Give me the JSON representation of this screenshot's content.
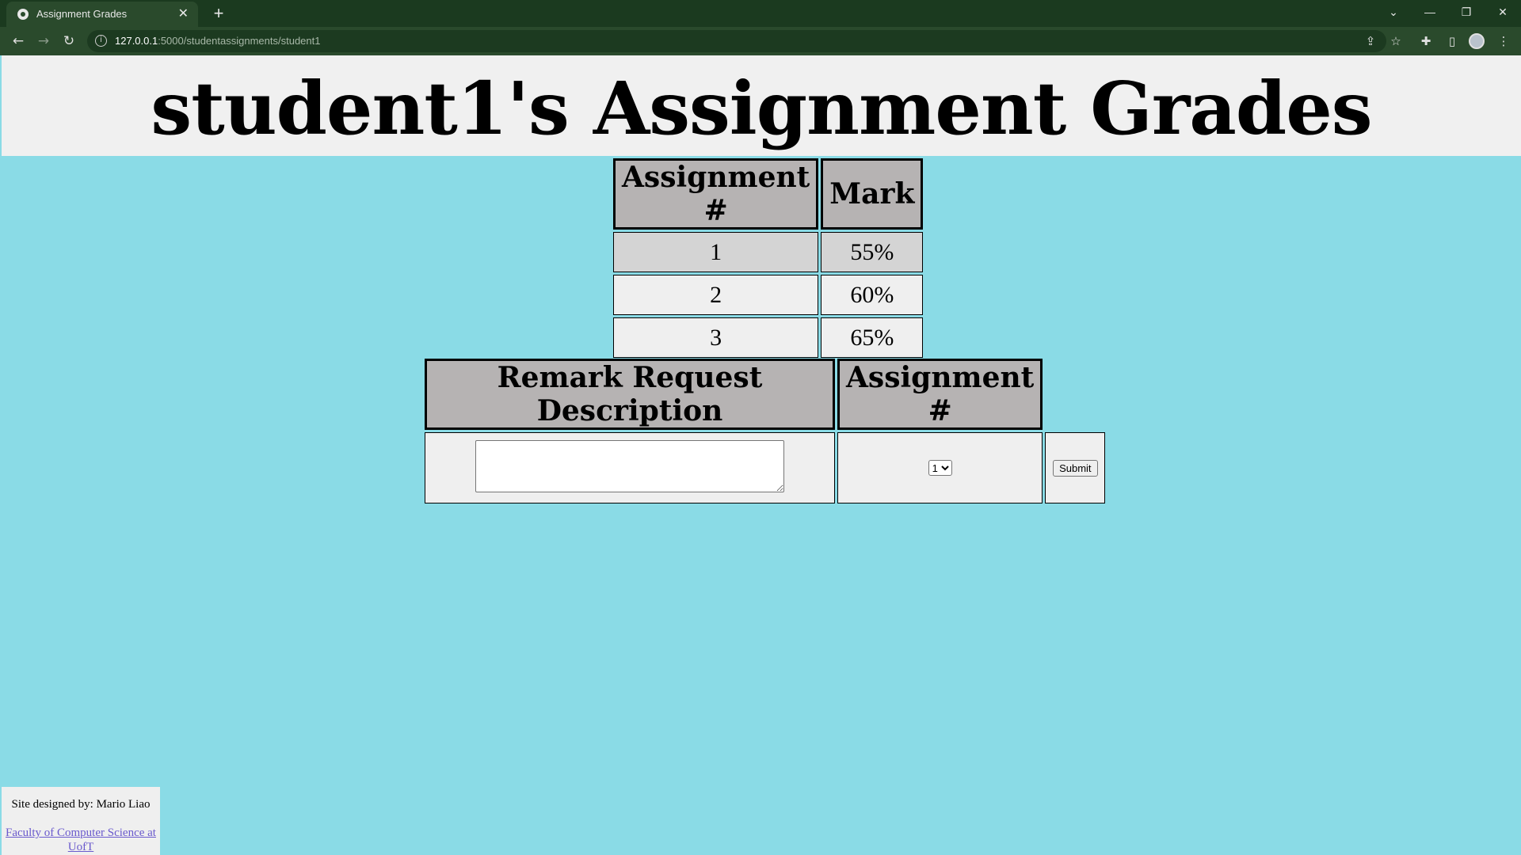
{
  "browser": {
    "tab_title": "Assignment Grades",
    "close_glyph": "✕",
    "new_tab_glyph": "+",
    "url_host": "127.0.0.1",
    "url_path": ":5000/studentassignments/student1",
    "info_glyph": "i"
  },
  "page": {
    "title": "student1's Assignment Grades",
    "grades_table": {
      "headers": [
        "Assignment #",
        "Mark"
      ],
      "rows": [
        {
          "assignment": "1",
          "mark": "55%"
        },
        {
          "assignment": "2",
          "mark": "60%"
        },
        {
          "assignment": "3",
          "mark": "65%"
        }
      ]
    },
    "remark_form": {
      "headers": [
        "Remark Request Description",
        "Assignment #"
      ],
      "description_value": "",
      "selected_assignment": "1",
      "submit_label": "Submit"
    },
    "footer": {
      "credit": "Site designed by: Mario Liao",
      "link_text": "Faculty of Computer Science at UofT"
    }
  },
  "colors": {
    "page_background": "#8adbe6",
    "header_background": "#f0f0f0",
    "table_header": "#b6b3b3",
    "link": "#6a5acd"
  }
}
